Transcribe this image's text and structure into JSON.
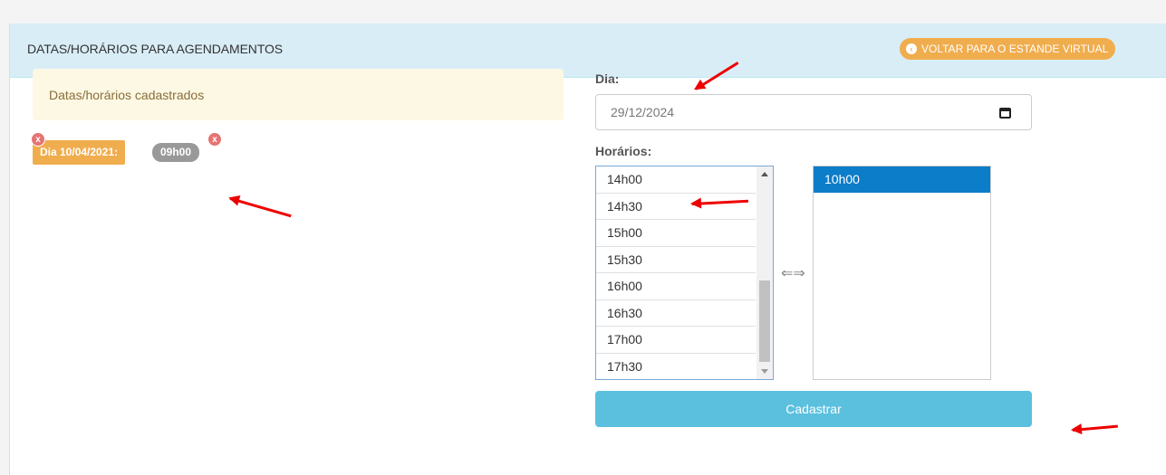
{
  "header": {
    "title": "DATAS/HORÁRIOS PARA AGENDAMENTOS",
    "back_label": "VOLTAR PARA O ESTANDE VIRTUAL",
    "back_icon": "chevron-left-circle-icon"
  },
  "registered": {
    "alert_text": "Datas/horários cadastrados",
    "day_tag": "Dia 10/04/2021:",
    "hour_tag": "09h00",
    "remove_glyph": "x"
  },
  "form": {
    "day_label": "Dia:",
    "day_value": "29/12/2024",
    "hours_label": "Horários:",
    "available_hours": [
      "14h00",
      "14h30",
      "15h00",
      "15h30",
      "16h00",
      "16h30",
      "17h00",
      "17h30"
    ],
    "selected_hours": [
      "10h00"
    ],
    "swap_glyph": "⇐⇒",
    "submit_label": "Cadastrar"
  },
  "colors": {
    "header_bg": "#d9edf7",
    "warning": "#f0ad4e",
    "info": "#5bc0de",
    "selected": "#0b7dc9",
    "annotation": "#e00000"
  }
}
